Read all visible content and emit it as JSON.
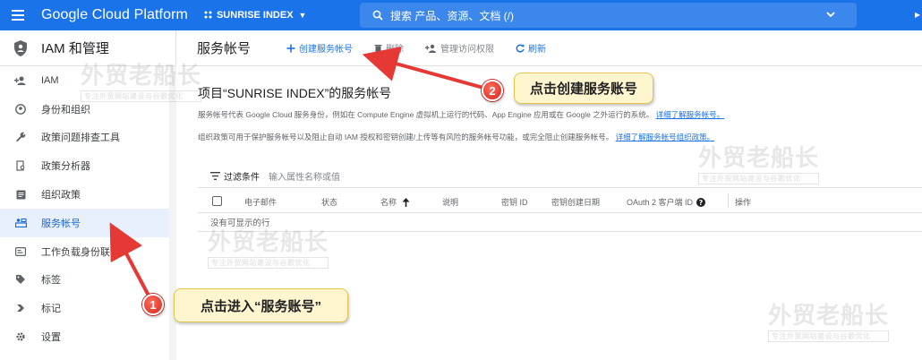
{
  "topbar": {
    "brand": "Google Cloud Platform",
    "project": "SUNRISE INDEX",
    "search_placeholder": "搜索  产品、资源、文档 (/)"
  },
  "sidebar": {
    "title": "IAM 和管理",
    "items": [
      {
        "label": "IAM",
        "icon": "person-add-icon"
      },
      {
        "label": "身份和组织",
        "icon": "account-circle-icon"
      },
      {
        "label": "政策问题排查工具",
        "icon": "wrench-icon"
      },
      {
        "label": "政策分析器",
        "icon": "document-search-icon"
      },
      {
        "label": "组织政策",
        "icon": "list-box-icon"
      },
      {
        "label": "服务帐号",
        "icon": "service-account-icon",
        "active": true
      },
      {
        "label": "工作负载身份联合",
        "icon": "id-card-icon"
      },
      {
        "label": "标签",
        "icon": "tag-icon"
      },
      {
        "label": "标记",
        "icon": "label-icon"
      },
      {
        "label": "设置",
        "icon": "gear-icon"
      }
    ]
  },
  "main": {
    "page_title": "服务帐号",
    "actions": {
      "create": "创建服务帐号",
      "delete": "删除",
      "manage_access": "管理访问权限",
      "refresh": "刷新"
    },
    "section_title": "项目“SUNRISE INDEX”的服务帐号",
    "desc1": "服务帐号代表 Google Cloud 服务身份，例如在 Compute Engine 虚拟机上运行的代码、App Engine 应用或在 Google 之外运行的系统。",
    "desc1_link": "详细了解服务帐号。",
    "desc2": "组织政策可用于保护服务帐号以及阻止自动 IAM 授权和密钥创建/上传等有风险的服务帐号功能，或完全阻止创建服务帐号。",
    "desc2_link": "详细了解服务帐号组织政策。",
    "filter_label": "过滤条件",
    "filter_placeholder": "输入属性名称或值",
    "columns": [
      "电子邮件",
      "状态",
      "名称",
      "说明",
      "密钥 ID",
      "密钥创建日期",
      "OAuth 2 客户端 ID",
      "操作"
    ],
    "empty_text": "没有可显示的行"
  },
  "callouts": {
    "c1_text": "点击进入“服务账号”",
    "c1_num": "1",
    "c2_text": "点击创建服务账号",
    "c2_num": "2"
  },
  "watermark": {
    "text": "外贸老船长",
    "sub": "专注外贸网站建设与谷歌优化"
  },
  "colors": {
    "topbar": "#1a73e8",
    "active_bg": "#e8f0fe",
    "callout_bg": "#fff6cf",
    "badge": "#d7261c",
    "arrow": "#e53935"
  }
}
